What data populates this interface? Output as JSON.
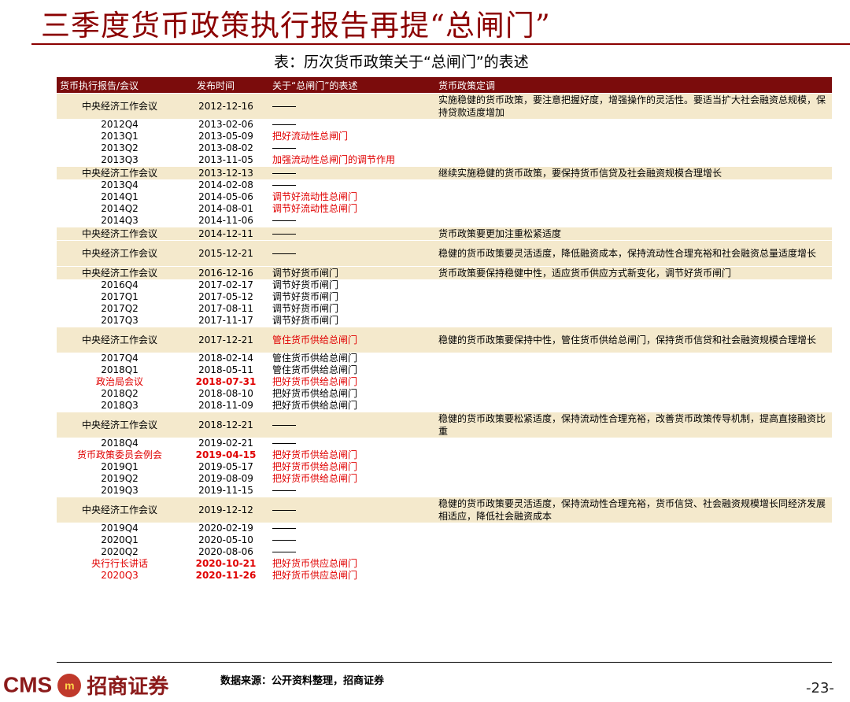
{
  "title": "三季度货币政策执行报告再提“总闸门”",
  "caption": "表：历次货币政策关于“总闸门”的表述",
  "table": {
    "headers": [
      "货币执行报告/会议",
      "发布时间",
      "关于“总闸门”的表述",
      "货币政策定调"
    ],
    "rows": [
      {
        "name": "中央经济工作会议",
        "date": "2012-12-16",
        "stmt": "——",
        "tone": "实施稳健的货币政策，要注意把握好度，增强操作的灵活性。要适当扩大社会融资总规模，保持贷款适度增加",
        "hl": true,
        "tall": true
      },
      {
        "name": "2012Q4",
        "date": "2013-02-06",
        "stmt": "——",
        "tone": ""
      },
      {
        "name": "2013Q1",
        "date": "2013-05-09",
        "stmt": "把好流动性总闸门",
        "tone": "",
        "stmtRed": true
      },
      {
        "name": "2013Q2",
        "date": "2013-08-02",
        "stmt": "——",
        "tone": ""
      },
      {
        "name": "2013Q3",
        "date": "2013-11-05",
        "stmt": "加强流动性总闸门的调节作用",
        "tone": "",
        "stmtRed": true
      },
      {
        "name": "中央经济工作会议",
        "date": "2013-12-13",
        "stmt": "——",
        "tone": "继续实施稳健的货币政策，要保持货币信贷及社会融资规模合理增长",
        "hl": true
      },
      {
        "name": "2013Q4",
        "date": "2014-02-08",
        "stmt": "——",
        "tone": ""
      },
      {
        "name": "2014Q1",
        "date": "2014-05-06",
        "stmt": "调节好流动性总闸门",
        "tone": "",
        "stmtRed": true
      },
      {
        "name": "2014Q2",
        "date": "2014-08-01",
        "stmt": "调节好流动性总闸门",
        "tone": "",
        "stmtRed": true
      },
      {
        "name": "2014Q3",
        "date": "2014-11-06",
        "stmt": "——",
        "tone": ""
      },
      {
        "name": "中央经济工作会议",
        "date": "2014-12-11",
        "stmt": "——",
        "tone": "货币政策要更加注重松紧适度",
        "hl": true
      },
      {
        "name": "中央经济工作会议",
        "date": "2015-12-21",
        "stmt": "——",
        "tone": "稳健的货币政策要灵活适度，降低融资成本，保持流动性合理充裕和社会融资总量适度增长",
        "hl": true,
        "tall": true
      },
      {
        "name": "中央经济工作会议",
        "date": "2016-12-16",
        "stmt": "调节好货币闸门",
        "tone": "货币政策要保持稳健中性，适应货币供应方式新变化，调节好货币闸门",
        "hl": true
      },
      {
        "name": "2016Q4",
        "date": "2017-02-17",
        "stmt": "调节好货币闸门",
        "tone": ""
      },
      {
        "name": "2017Q1",
        "date": "2017-05-12",
        "stmt": "调节好货币闸门",
        "tone": ""
      },
      {
        "name": "2017Q2",
        "date": "2017-08-11",
        "stmt": "调节好货币闸门",
        "tone": ""
      },
      {
        "name": "2017Q3",
        "date": "2017-11-17",
        "stmt": "调节好货币闸门",
        "tone": ""
      },
      {
        "name": "中央经济工作会议",
        "date": "2017-12-21",
        "stmt": "管住货币供给总闸门",
        "tone": "稳健的货币政策要保持中性，管住货币供给总闸门，保持货币信贷和社会融资规模合理增长",
        "hl": true,
        "tall": true,
        "stmtRed": true
      },
      {
        "name": "2017Q4",
        "date": "2018-02-14",
        "stmt": "管住货币供给总闸门",
        "tone": ""
      },
      {
        "name": "2018Q1",
        "date": "2018-05-11",
        "stmt": "管住货币供给总闸门",
        "tone": ""
      },
      {
        "name": "政治局会议",
        "date": "2018-07-31",
        "stmt": "把好货币供给总闸门",
        "tone": "",
        "allRed": true
      },
      {
        "name": "2018Q2",
        "date": "2018-08-10",
        "stmt": "把好货币供给总闸门",
        "tone": ""
      },
      {
        "name": "2018Q3",
        "date": "2018-11-09",
        "stmt": "把好货币供给总闸门",
        "tone": ""
      },
      {
        "name": "中央经济工作会议",
        "date": "2018-12-21",
        "stmt": "——",
        "tone": "稳健的货币政策要松紧适度，保持流动性合理充裕，改善货币政策传导机制，提高直接融资比重",
        "hl": true,
        "tall": true
      },
      {
        "name": "2018Q4",
        "date": "2019-02-21",
        "stmt": "——",
        "tone": ""
      },
      {
        "name": "货币政策委员会例会",
        "date": "2019-04-15",
        "stmt": "把好货币供给总闸门",
        "tone": "",
        "allRed": true
      },
      {
        "name": "2019Q1",
        "date": "2019-05-17",
        "stmt": "把好货币供给总闸门",
        "tone": "",
        "stmtRed": true
      },
      {
        "name": "2019Q2",
        "date": "2019-08-09",
        "stmt": "把好货币供给总闸门",
        "tone": "",
        "stmtRed": true
      },
      {
        "name": "2019Q3",
        "date": "2019-11-15",
        "stmt": "——",
        "tone": ""
      },
      {
        "name": "中央经济工作会议",
        "date": "2019-12-12",
        "stmt": "——",
        "tone": "稳健的货币政策要灵活适度，保持流动性合理充裕，货币信贷、社会融资规模增长同经济发展相适应，降低社会融资成本",
        "hl": true,
        "tall": true
      },
      {
        "name": "2019Q4",
        "date": "2020-02-19",
        "stmt": "——",
        "tone": ""
      },
      {
        "name": "2020Q1",
        "date": "2020-05-10",
        "stmt": "——",
        "tone": ""
      },
      {
        "name": "2020Q2",
        "date": "2020-08-06",
        "stmt": "——",
        "tone": ""
      },
      {
        "name": "央行行长讲话",
        "date": "2020-10-21",
        "stmt": "把好货币供应总闸门",
        "tone": "",
        "allRed": true
      },
      {
        "name": "2020Q3",
        "date": "2020-11-26",
        "stmt": "把好货币供应总闸门",
        "tone": "",
        "allRed": true
      }
    ]
  },
  "footer": {
    "logo_cms": "CMS",
    "logo_mark": "m",
    "logo_cn": "招商证券",
    "source": "数据来源：公开资料整理，招商证券",
    "page": "-23-"
  }
}
